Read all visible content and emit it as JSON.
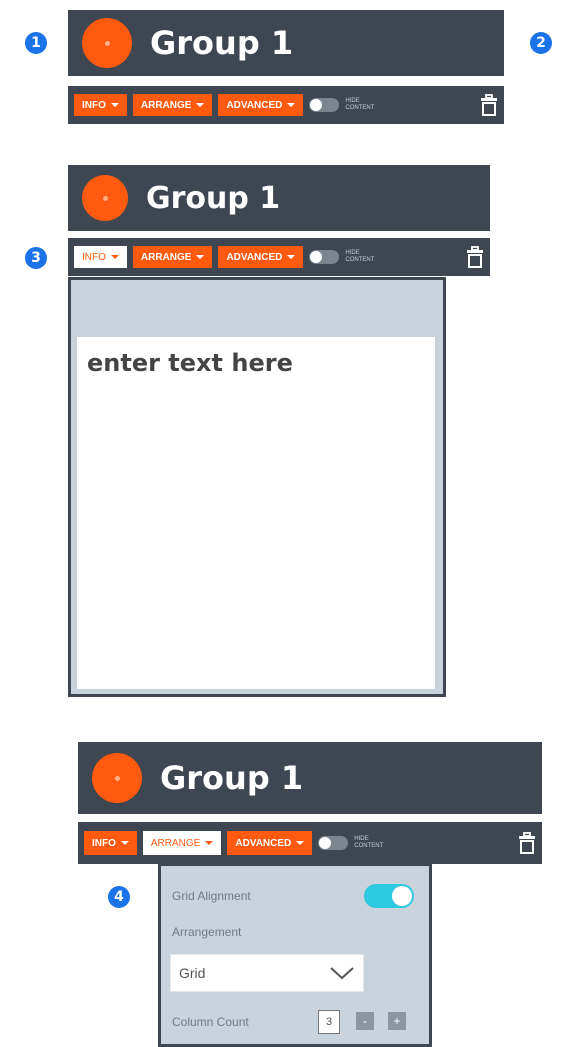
{
  "badges": [
    "1",
    "2",
    "3",
    "4"
  ],
  "group_title": "Group 1",
  "toolbar": {
    "info": "INFO",
    "arrange": "ARRANGE",
    "advanced": "ADVANCED",
    "hide_content": "HIDE CONTENT"
  },
  "text_panel": {
    "placeholder": "enter text here"
  },
  "arrange_panel": {
    "grid_alignment_label": "Grid Alignment",
    "grid_alignment_on": true,
    "arrangement_label": "Arrangement",
    "arrangement_value": "Grid",
    "column_count_label": "Column Count",
    "column_count_value": "3",
    "minus": "-",
    "plus": "+"
  },
  "colors": {
    "header": "#3d4651",
    "accent": "#ff5a0f",
    "badge": "#1a73e8",
    "toggle_on": "#2ec8e0",
    "panel": "#c9d3dc"
  }
}
